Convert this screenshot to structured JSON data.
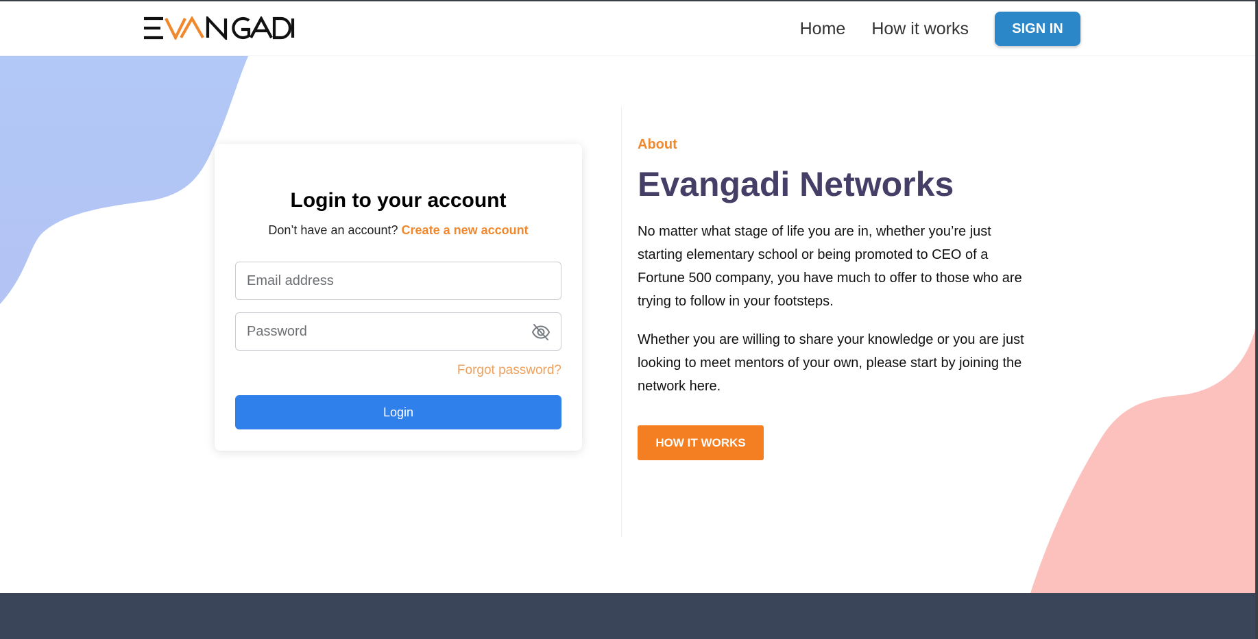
{
  "brand": {
    "name": "EVANGADI",
    "accent": "#f0882e"
  },
  "nav": {
    "links": [
      "Home",
      "How it works"
    ],
    "signin_label": "SIGN IN"
  },
  "login": {
    "title": "Login to your account",
    "prompt": "Don’t have an account?",
    "create_link": "Create a new account",
    "email_placeholder": "Email address",
    "password_placeholder": "Password",
    "password_toggle_icon": "eye-slash-icon",
    "forgot_label": "Forgot password?",
    "submit_label": "Login"
  },
  "about": {
    "label": "About",
    "title": "Evangadi Networks",
    "paragraphs": [
      "No matter what stage of life you are in, whether you’re just starting elementary school or being promoted to CEO of a Fortune 500 company, you have much to offer to those who are trying to follow in your footsteps.",
      "Whether you are willing to share your knowledge or you are just looking to meet mentors of your own, please start by joining the network here."
    ],
    "cta_label": "HOW IT WORKS"
  },
  "colors": {
    "primary_blue": "#2f80ea",
    "signin_blue": "#2b87c7",
    "orange": "#f37f22",
    "title_purple": "#453e66",
    "footer": "#3a4559",
    "blob_left": "#b0c6f6",
    "blob_right": "#fcc0bd"
  }
}
